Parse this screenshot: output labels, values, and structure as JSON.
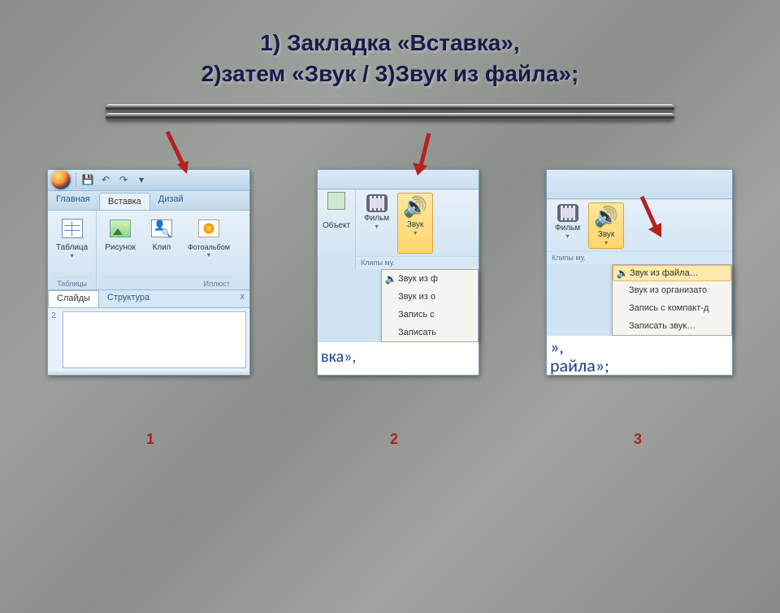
{
  "title": {
    "line1": "1) Закладка «Вставка»,",
    "line2": "2)затем  «Звук / 3)Звук из файла»;"
  },
  "panel1": {
    "tabs": {
      "home": "Главная",
      "insert": "Вставка",
      "design": "Дизай"
    },
    "ribbon": {
      "table": "Таблица",
      "picture": "Рисунок",
      "clip": "Клип",
      "album": "Фотоальбом",
      "group_tables": "Таблицы",
      "group_illust": "Иллюст"
    },
    "pane": {
      "slides": "Слайды",
      "outline": "Структура",
      "close": "x",
      "num": "2"
    }
  },
  "panel2": {
    "object": "Объект",
    "movie": "Фильм",
    "sound": "Звук",
    "group_clips": "Клипы му.",
    "menu": {
      "from_file": "Звук из ф",
      "from_org": "Звук из о",
      "record": "Запись с",
      "rec_sound": "Записать"
    },
    "canvas": "вка»,"
  },
  "panel3": {
    "movie": "Фильм",
    "sound": "Звук",
    "group_clips": "Клипы му.",
    "menu": {
      "from_file": "Звук из файла…",
      "from_org": "Звук из организато",
      "from_cd": "Запись с компакт-д",
      "rec_sound": "Записать звук…"
    },
    "canvas1": "»,",
    "canvas2": "райла»;"
  },
  "labels": {
    "n1": "1",
    "n2": "2",
    "n3": "3"
  }
}
